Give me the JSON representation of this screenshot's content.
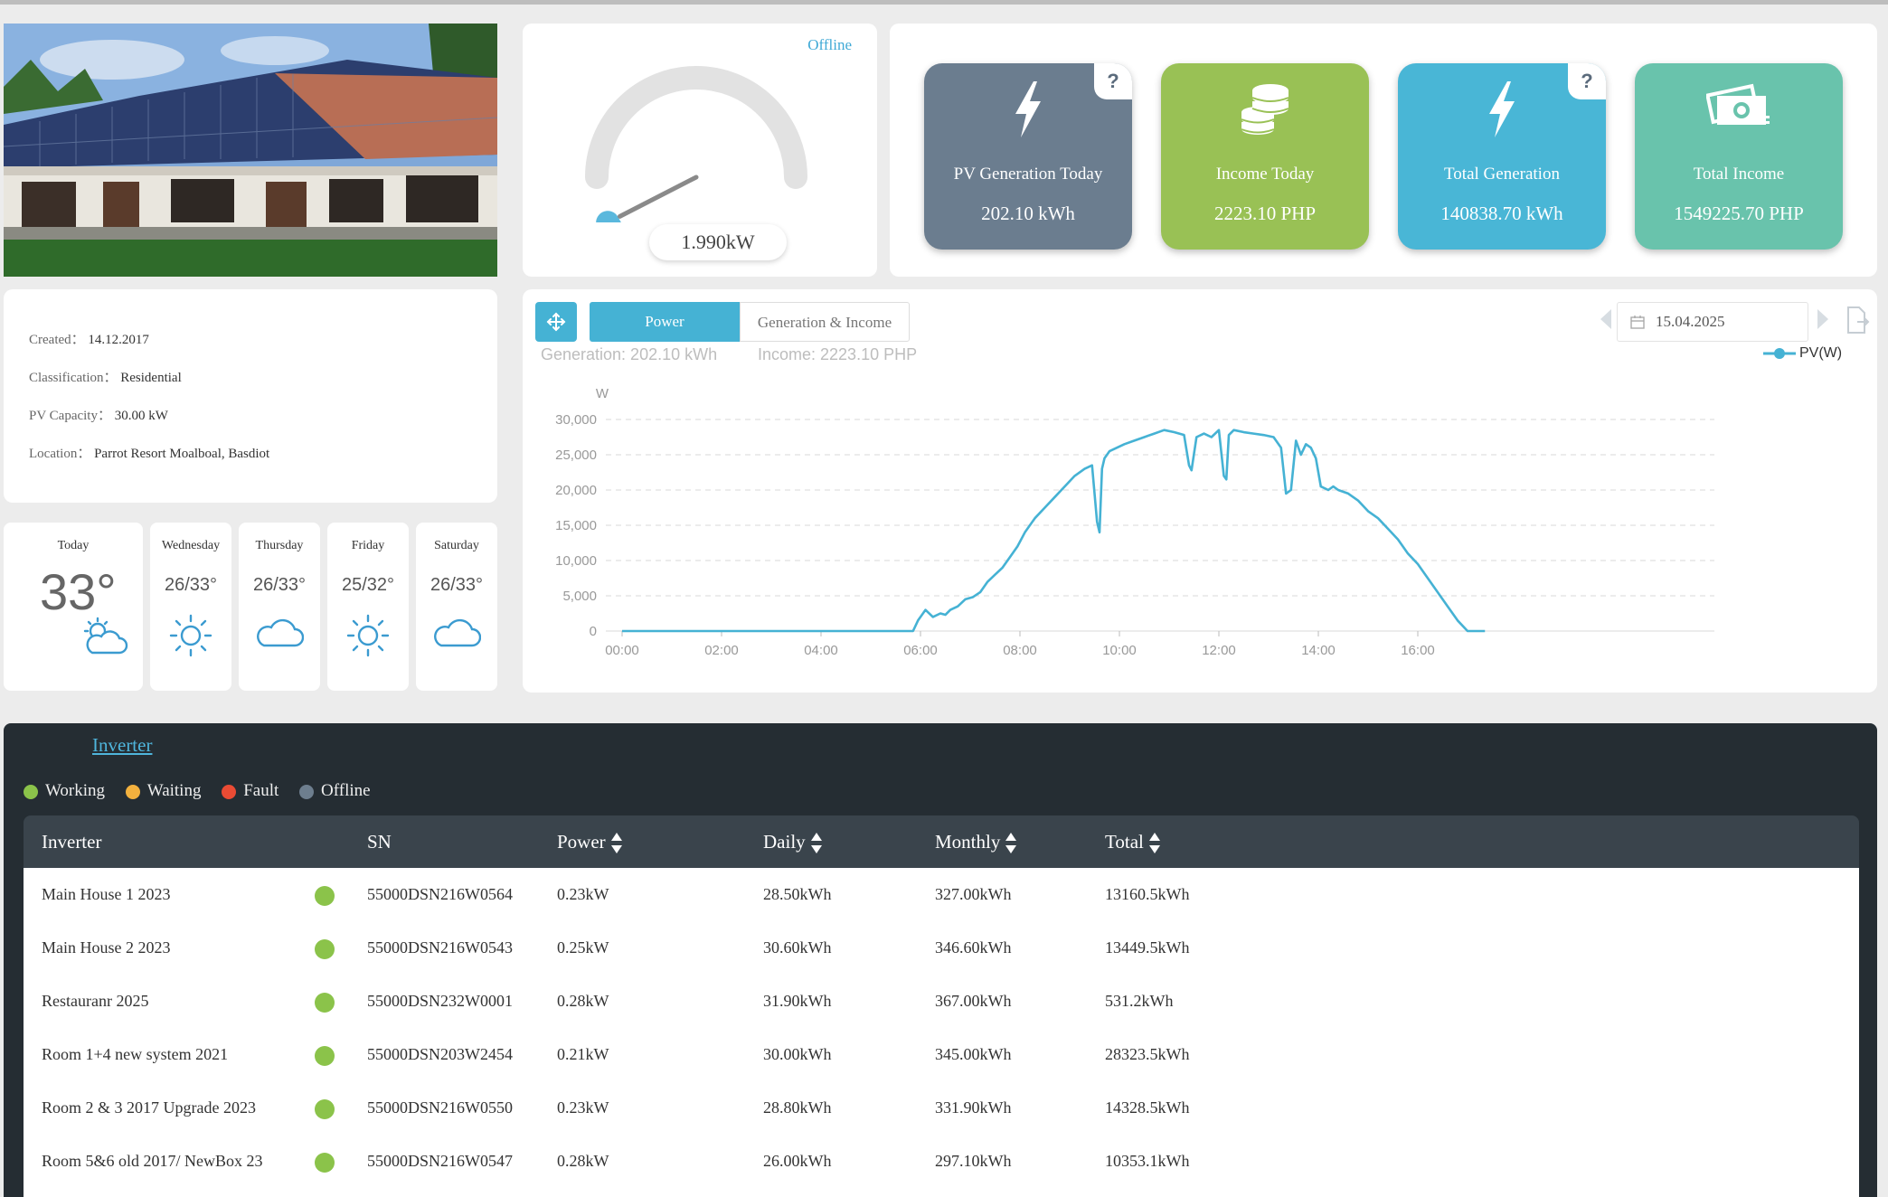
{
  "gauge": {
    "status": "Offline",
    "value": "1.990kW",
    "level_fraction": 0.066
  },
  "stats": [
    {
      "label": "PV Generation Today",
      "value": "202.10 kWh",
      "color": "#6b7d8f",
      "icon": "lightning-icon",
      "help": "?"
    },
    {
      "label": "Income Today",
      "value": "2223.10 PHP",
      "color": "#99c155",
      "icon": "coins-icon",
      "help": ""
    },
    {
      "label": "Total Generation",
      "value": "140838.70 kWh",
      "color": "#49b6d6",
      "icon": "lightning-icon",
      "help": "?"
    },
    {
      "label": "Total Income",
      "value": "1549225.70 PHP",
      "color": "#69c3ac",
      "icon": "money-icon",
      "help": ""
    }
  ],
  "info": {
    "created_label": "Created：",
    "created": "14.12.2017",
    "class_label": "Classification：",
    "classification": "Residential",
    "capacity_label": "PV Capacity：",
    "capacity": "30.00 kW",
    "location_label": "Location：",
    "location": "Parrot Resort Moalboal, Basdiot"
  },
  "weather": {
    "today": {
      "day": "Today",
      "temp": "33°",
      "icon": "partly-cloudy-icon"
    },
    "days": [
      {
        "day": "Wednesday",
        "temp": "26/33°",
        "icon": "sun-icon"
      },
      {
        "day": "Thursday",
        "temp": "26/33°",
        "icon": "cloud-icon"
      },
      {
        "day": "Friday",
        "temp": "25/32°",
        "icon": "sun-icon"
      },
      {
        "day": "Saturday",
        "temp": "26/33°",
        "icon": "cloud-icon"
      }
    ]
  },
  "chart_panel": {
    "tab_power": "Power",
    "tab_gen_income": "Generation & Income",
    "generation": "Generation: 202.10 kWh",
    "income": "Income: 2223.10 PHP",
    "date": "15.04.2025",
    "accent": "#45b2d4"
  },
  "chart_data": {
    "type": "line",
    "ylabel": "W",
    "ylim": [
      0,
      30000
    ],
    "yticks": [
      "0",
      "5,000",
      "10,000",
      "15,000",
      "20,000",
      "25,000",
      "30,000"
    ],
    "xticks": [
      "00:00",
      "02:00",
      "04:00",
      "06:00",
      "08:00",
      "10:00",
      "12:00",
      "14:00",
      "16:00"
    ],
    "xlim_hours": [
      0,
      17.4
    ],
    "legend": "top-right",
    "grid": true,
    "series": [
      {
        "name": "PV(W)",
        "color": "#45b2d4",
        "x": [
          0,
          5.85,
          5.95,
          6.1,
          6.25,
          6.4,
          6.5,
          6.6,
          6.75,
          6.9,
          7.05,
          7.2,
          7.35,
          7.5,
          7.65,
          7.8,
          7.95,
          8.1,
          8.3,
          8.5,
          8.7,
          8.9,
          9.1,
          9.3,
          9.45,
          9.55,
          9.6,
          9.65,
          9.7,
          9.8,
          9.95,
          10.1,
          10.3,
          10.5,
          10.7,
          10.9,
          11.1,
          11.3,
          11.4,
          11.45,
          11.55,
          11.7,
          11.85,
          12.0,
          12.1,
          12.15,
          12.2,
          12.3,
          12.5,
          12.7,
          12.9,
          13.1,
          13.25,
          13.35,
          13.45,
          13.55,
          13.65,
          13.75,
          13.85,
          13.95,
          14.05,
          14.2,
          14.3,
          14.4,
          14.6,
          14.8,
          15.0,
          15.2,
          15.4,
          15.6,
          15.8,
          16.0,
          16.2,
          16.4,
          16.6,
          16.8,
          17.0,
          17.2,
          17.35
        ],
        "y": [
          0,
          0,
          1500,
          3000,
          2000,
          2500,
          2300,
          3000,
          3500,
          4500,
          4800,
          5500,
          7000,
          8000,
          9000,
          10500,
          12000,
          14000,
          16000,
          17500,
          19000,
          20500,
          22000,
          23000,
          23500,
          15500,
          14000,
          23000,
          24500,
          25500,
          26000,
          26500,
          27000,
          27500,
          28000,
          28500,
          28200,
          27800,
          23500,
          22800,
          27500,
          28000,
          27500,
          28500,
          22000,
          21500,
          27800,
          28500,
          28200,
          28000,
          27800,
          27500,
          26000,
          19500,
          20000,
          27000,
          25000,
          26500,
          26000,
          24500,
          20500,
          20000,
          20500,
          20000,
          19500,
          18500,
          17000,
          16000,
          14500,
          13000,
          11000,
          9500,
          7500,
          5500,
          3500,
          1500,
          0,
          0,
          0
        ]
      }
    ]
  },
  "inverter": {
    "title": "Inverter",
    "legend": [
      {
        "label": "Working",
        "color": "#8bc34a"
      },
      {
        "label": "Waiting",
        "color": "#f3b13e"
      },
      {
        "label": "Fault",
        "color": "#ea4b34"
      },
      {
        "label": "Offline",
        "color": "#6d7e8e"
      }
    ],
    "columns": {
      "name": "Inverter",
      "sn": "SN",
      "power": "Power",
      "daily": "Daily",
      "monthly": "Monthly",
      "total": "Total"
    },
    "status_color": "#8bc34a",
    "rows": [
      {
        "name": "Main House 1 2023",
        "sn": "55000DSN216W0564",
        "power": "0.23kW",
        "daily": "28.50kWh",
        "monthly": "327.00kWh",
        "total": "13160.5kWh"
      },
      {
        "name": "Main House 2 2023",
        "sn": "55000DSN216W0543",
        "power": "0.25kW",
        "daily": "30.60kWh",
        "monthly": "346.60kWh",
        "total": "13449.5kWh"
      },
      {
        "name": "Restauranr 2025",
        "sn": "55000DSN232W0001",
        "power": "0.28kW",
        "daily": "31.90kWh",
        "monthly": "367.00kWh",
        "total": "531.2kWh"
      },
      {
        "name": "Room 1+4 new system 2021",
        "sn": "55000DSN203W2454",
        "power": "0.21kW",
        "daily": "30.00kWh",
        "monthly": "345.00kWh",
        "total": "28323.5kWh"
      },
      {
        "name": "Room 2 & 3 2017 Upgrade 2023",
        "sn": "55000DSN216W0550",
        "power": "0.23kW",
        "daily": "28.80kWh",
        "monthly": "331.90kWh",
        "total": "14328.5kWh"
      },
      {
        "name": "Room 5&6 old 2017/ NewBox 23",
        "sn": "55000DSN216W0547",
        "power": "0.28kW",
        "daily": "26.00kWh",
        "monthly": "297.10kWh",
        "total": "10353.1kWh"
      }
    ]
  }
}
